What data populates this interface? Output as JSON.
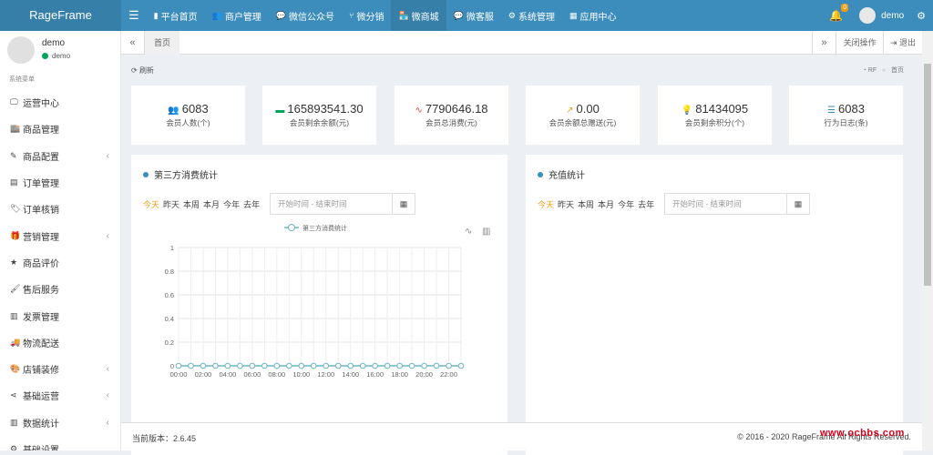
{
  "brand": "RageFrame",
  "nav": [
    {
      "label": "平台首页",
      "icon": "bookmark-icon",
      "glyph": "▮"
    },
    {
      "label": "商户管理",
      "icon": "users-icon",
      "glyph": "👥"
    },
    {
      "label": "微信公众号",
      "icon": "wechat-icon",
      "glyph": "💬"
    },
    {
      "label": "微分销",
      "icon": "branch-icon",
      "glyph": "⑂"
    },
    {
      "label": "微商城",
      "icon": "shop-icon",
      "glyph": "🏪"
    },
    {
      "label": "微客服",
      "icon": "chat-icon",
      "glyph": "💬"
    },
    {
      "label": "系统管理",
      "icon": "cogs-icon",
      "glyph": "⚙"
    },
    {
      "label": "应用中心",
      "icon": "grid-icon",
      "glyph": "▦"
    }
  ],
  "active_nav": "微商城",
  "header": {
    "notification_count": "0",
    "username": "demo"
  },
  "sidebar": {
    "user_name": "demo",
    "status": "demo",
    "section_header": "系统菜单",
    "items": [
      {
        "label": "运营中心",
        "icon": "desktop-icon",
        "glyph": "🖵",
        "chevron": ""
      },
      {
        "label": "商品管理",
        "icon": "store-icon",
        "glyph": "🏬",
        "chevron": ""
      },
      {
        "label": "商品配置",
        "icon": "pencil-icon",
        "glyph": "✎",
        "chevron": "‹"
      },
      {
        "label": "订单管理",
        "icon": "file-icon",
        "glyph": "▤",
        "chevron": ""
      },
      {
        "label": "订单核销",
        "icon": "tag-icon",
        "glyph": "🏷",
        "chevron": ""
      },
      {
        "label": "营销管理",
        "icon": "gift-icon",
        "glyph": "🎁",
        "chevron": "‹"
      },
      {
        "label": "商品评价",
        "icon": "star-icon",
        "glyph": "★",
        "chevron": ""
      },
      {
        "label": "售后服务",
        "icon": "paint-brush-icon",
        "glyph": "🖌",
        "chevron": ""
      },
      {
        "label": "发票管理",
        "icon": "invoice-icon",
        "glyph": "▥",
        "chevron": ""
      },
      {
        "label": "物流配送",
        "icon": "truck-icon",
        "glyph": "🚚",
        "chevron": ""
      },
      {
        "label": "店铺装修",
        "icon": "palette-icon",
        "glyph": "🎨",
        "chevron": "‹"
      },
      {
        "label": "基础运营",
        "icon": "share-icon",
        "glyph": "⋖",
        "chevron": "‹"
      },
      {
        "label": "数据统计",
        "icon": "bar-chart-icon",
        "glyph": "▥",
        "chevron": "‹"
      },
      {
        "label": "基础设置",
        "icon": "settings-icon",
        "glyph": "⚙",
        "chevron": ""
      }
    ]
  },
  "tabs": {
    "prev": "«",
    "current": "首页",
    "next": "»",
    "close_ops": "关闭操作",
    "logout": "退出"
  },
  "toolbar": {
    "refresh": "刷新",
    "breadcrumb_root": "RF",
    "breadcrumb_sep": "»",
    "breadcrumb_current": "首页"
  },
  "stats": [
    {
      "value": "6083",
      "label": "会员人数(个)",
      "icon": "users-icon",
      "glyph": "👥",
      "color": "#3c8dbc"
    },
    {
      "value": "165893541.30",
      "label": "会员剩余余额(元)",
      "icon": "credit-card-icon",
      "glyph": "▬",
      "color": "#00a65a"
    },
    {
      "value": "7790646.18",
      "label": "会员总消费(元)",
      "icon": "heartbeat-icon",
      "glyph": "∿",
      "color": "#dd4b39"
    },
    {
      "value": "0.00",
      "label": "会员余额总赠送(元)",
      "icon": "line-chart-icon",
      "glyph": "↗",
      "color": "#f39c12"
    },
    {
      "value": "81434095",
      "label": "会员剩余积分(个)",
      "icon": "lightbulb-icon",
      "glyph": "💡",
      "color": "#dd4b39"
    },
    {
      "value": "6083",
      "label": "行为日志(条)",
      "icon": "list-icon",
      "glyph": "☰",
      "color": "#3c8dbc"
    }
  ],
  "panel_left": {
    "title": "第三方消费统计",
    "ranges": [
      "今天",
      "昨天",
      "本周",
      "本月",
      "今年",
      "去年"
    ],
    "date_placeholder": "开始时间 - 结束时间"
  },
  "panel_right": {
    "title": "充值统计",
    "ranges": [
      "今天",
      "昨天",
      "本周",
      "本月",
      "今年",
      "去年"
    ],
    "date_placeholder": "开始时间 - 结束时间"
  },
  "chart_data": {
    "type": "line",
    "legend": "第三方消费统计",
    "x": [
      "00:00",
      "01:00",
      "02:00",
      "03:00",
      "04:00",
      "05:00",
      "06:00",
      "07:00",
      "08:00",
      "09:00",
      "10:00",
      "11:00",
      "12:00",
      "13:00",
      "14:00",
      "15:00",
      "16:00",
      "17:00",
      "18:00",
      "19:00",
      "20:00",
      "21:00",
      "22:00",
      "23:00"
    ],
    "x_tick_labels": [
      "00:00",
      "02:00",
      "04:00",
      "06:00",
      "08:00",
      "10:00",
      "12:00",
      "14:00",
      "16:00",
      "18:00",
      "20:00",
      "22:00"
    ],
    "series": [
      {
        "name": "第三方消费统计",
        "values": [
          0,
          0,
          0,
          0,
          0,
          0,
          0,
          0,
          0,
          0,
          0,
          0,
          0,
          0,
          0,
          0,
          0,
          0,
          0,
          0,
          0,
          0,
          0,
          0
        ]
      }
    ],
    "y_ticks": [
      "0",
      "0.2",
      "0.4",
      "0.6",
      "0.8",
      "1"
    ],
    "ylim": [
      0,
      1
    ],
    "grid": true,
    "line_color": "#6bb5c9"
  },
  "footer": {
    "version": "当前版本：2.6.45",
    "copyright": "© 2016 - 2020 RageFrame All Rights Reserved."
  },
  "watermark": "www.ocbbs.com"
}
